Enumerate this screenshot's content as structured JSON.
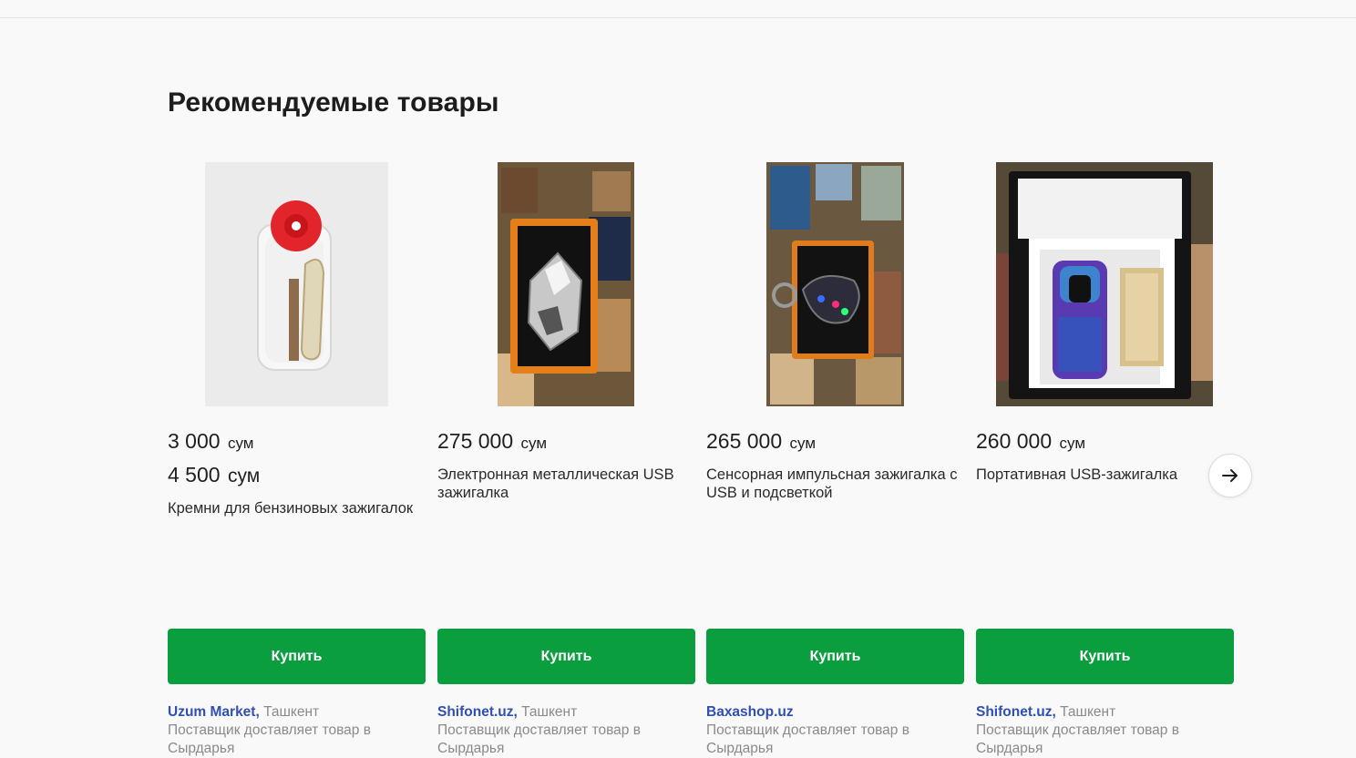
{
  "section": {
    "title": "Рекомендуемые товары"
  },
  "colors": {
    "buy_button": "#0b9e3f",
    "shop_link": "#2f4fb3",
    "muted_text": "#8a8a8a"
  },
  "products": [
    {
      "price": "3 000",
      "currency": "сум",
      "old_price": "4 500",
      "old_currency": "сум",
      "title": "Кремни для бензиновых зажигалок",
      "buy_label": "Купить",
      "shop": "Uzum Market,",
      "city": "Ташкент",
      "delivery": "Поставщик доставляет товар в Сырдарья",
      "image_icon": "flints-pack-image"
    },
    {
      "price": "275 000",
      "currency": "сум",
      "title": "Электронная металлическая USB зажигалка",
      "buy_label": "Купить",
      "shop": "Shifonet.uz,",
      "city": "Ташкент",
      "delivery": "Поставщик доставляет товар в Сырдарья",
      "image_icon": "usb-lighter-box-image"
    },
    {
      "price": "265 000",
      "currency": "сум",
      "title": "Сенсорная импульсная зажигалка с USB и подсветкой",
      "buy_label": "Купить",
      "shop": "Baxashop.uz",
      "city": "",
      "delivery": "Поставщик доставляет товар в Сырдарья",
      "image_icon": "touch-lighter-image"
    },
    {
      "price": "260 000",
      "currency": "сум",
      "title": "Портативная USB-зажигалка",
      "buy_label": "Купить",
      "shop": "Shifonet.uz,",
      "city": "Ташкент",
      "delivery": "Поставщик доставляет товар в Сырдарья",
      "image_icon": "gift-box-lighter-image"
    }
  ],
  "carousel": {
    "next_icon": "arrow-right-icon"
  }
}
